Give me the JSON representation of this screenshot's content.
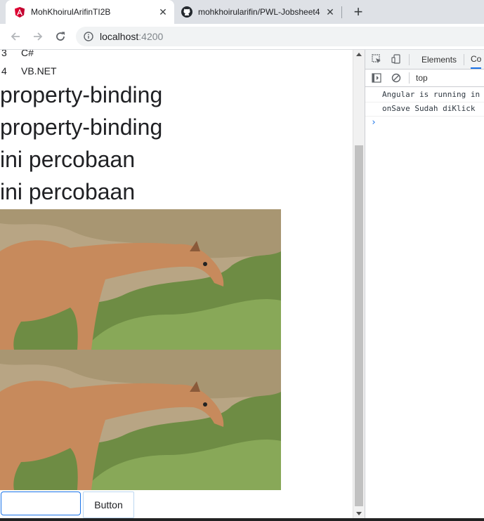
{
  "browser": {
    "tabs": [
      {
        "title": "MohKhoirulArifinTI2B",
        "active": true,
        "favicon": "angular-icon"
      },
      {
        "title": "mohkhoirularifin/PWL-Jobsheet4",
        "active": false,
        "favicon": "github-icon"
      }
    ],
    "new_tab": "+",
    "close": "✕",
    "url_host": "localhost",
    "url_port": ":4200"
  },
  "page": {
    "languages": [
      {
        "num": "3",
        "name": "C#"
      },
      {
        "num": "4",
        "name": "VB.NET"
      }
    ],
    "headings": [
      "property-binding",
      "property-binding",
      "ini percobaan",
      "ini percobaan"
    ],
    "images": [
      "giraffe-image",
      "giraffe-image"
    ],
    "input_value": "",
    "button_label": "Button"
  },
  "devtools": {
    "tabs": [
      "Elements",
      "Co"
    ],
    "context": "top",
    "logs": [
      "Angular is running in",
      "onSave Sudah diKlick"
    ],
    "prompt": "›"
  },
  "colors": {
    "accent": "#1a73e8",
    "angular_red": "#dd0031",
    "tabbar": "#dee1e6"
  }
}
